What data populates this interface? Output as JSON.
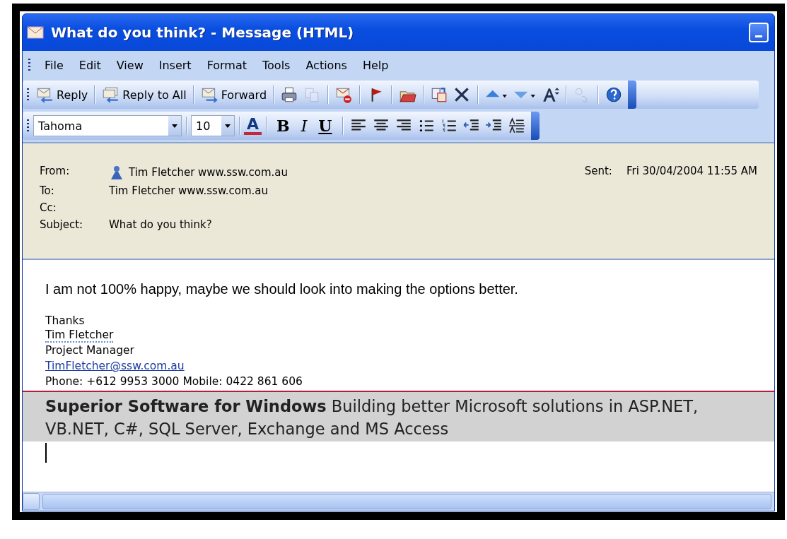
{
  "window": {
    "title": "What do you think? - Message (HTML)"
  },
  "menu": [
    {
      "label": "File"
    },
    {
      "label": "Edit"
    },
    {
      "label": "View"
    },
    {
      "label": "Insert"
    },
    {
      "label": "Format"
    },
    {
      "label": "Tools"
    },
    {
      "label": "Actions"
    },
    {
      "label": "Help"
    }
  ],
  "toolbar": {
    "groups": [
      [
        {
          "kind": "reply",
          "label": "Reply",
          "disabled": false
        }
      ],
      [
        {
          "kind": "reply_all",
          "label": "Reply to All",
          "disabled": false
        }
      ],
      [
        {
          "kind": "forward",
          "label": "Forward",
          "disabled": false
        }
      ],
      [
        {
          "kind": "print",
          "disabled": false
        },
        {
          "kind": "copy",
          "disabled": true
        }
      ],
      [
        {
          "kind": "mail_delete",
          "disabled": false
        }
      ],
      [
        {
          "kind": "flag",
          "disabled": false
        }
      ],
      [
        {
          "kind": "folder",
          "disabled": false
        }
      ],
      [
        {
          "kind": "move",
          "disabled": false
        },
        {
          "kind": "delete",
          "disabled": false
        }
      ],
      [
        {
          "kind": "previous",
          "disabled": false
        },
        {
          "kind": "next",
          "disabled": false
        },
        {
          "kind": "font_size",
          "disabled": false
        }
      ],
      [
        {
          "kind": "translate",
          "disabled": true
        }
      ],
      [
        {
          "kind": "help",
          "disabled": false
        }
      ]
    ]
  },
  "format_bar": {
    "font": "Tahoma",
    "size": "10",
    "groups": [
      [
        {
          "kind": "font_color",
          "label": "A"
        }
      ],
      [
        {
          "kind": "bold",
          "label": "B"
        },
        {
          "kind": "italic",
          "label": "I"
        },
        {
          "kind": "underline",
          "label": "U"
        }
      ],
      [
        {
          "kind": "align_left"
        },
        {
          "kind": "center"
        },
        {
          "kind": "align_right"
        },
        {
          "kind": "bullets"
        },
        {
          "kind": "numbering"
        },
        {
          "kind": "outdent"
        },
        {
          "kind": "indent"
        },
        {
          "kind": "style"
        }
      ]
    ]
  },
  "header": {
    "fields": [
      {
        "kind": "contact",
        "label": "From:",
        "value": "Tim Fletcher www.ssw.com.au"
      },
      {
        "kind": "plain",
        "label": "To:",
        "value": "Tim Fletcher www.ssw.com.au"
      },
      {
        "kind": "plain",
        "label": "Cc:"
      },
      {
        "kind": "plain",
        "label": "Subject:",
        "value": "What do you think?"
      }
    ],
    "sent": {
      "label": "Sent:",
      "value": "Fri 30/04/2004 11:55 AM"
    }
  },
  "body": {
    "message": "I am not 100% happy, maybe we should look into making the options better.",
    "signature": [
      {
        "kind": "text",
        "text": "Thanks"
      },
      {
        "kind": "flagged",
        "text": "Tim Fletcher"
      },
      {
        "kind": "text",
        "text": "Project Manager"
      },
      {
        "kind": "link",
        "text": "TimFletcher@ssw.com.au"
      },
      {
        "kind": "text",
        "text": "Phone: +612 9953 3000 Mobile: 0422 861 606"
      }
    ],
    "banner": "**Superior Software for Windows** Building better Microsoft solutions in ASP.NET, VB.NET, C#, SQL Server, Exchange and MS Access"
  }
}
